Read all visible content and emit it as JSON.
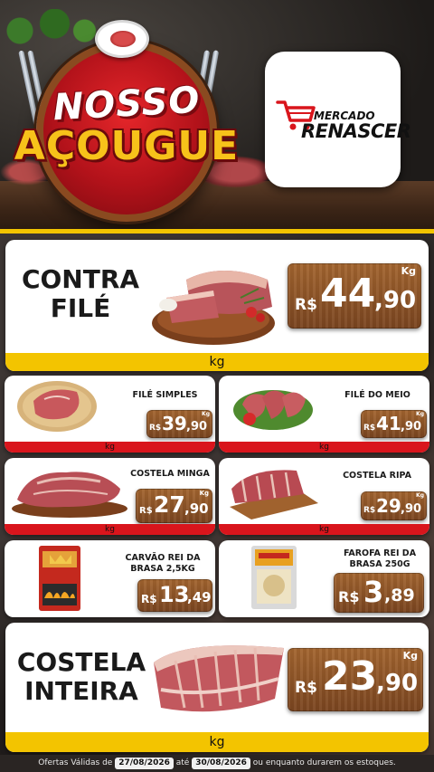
{
  "header": {
    "banner_line1": "NOSSO",
    "banner_line2": "AÇOUGUE",
    "logo_line1": "MERCADO",
    "logo_line2": "RENASCER"
  },
  "colors": {
    "yellow": "#f3c400",
    "red": "#d9151c",
    "wood": "#8a5128"
  },
  "featured_top": {
    "name_line1": "CONTRA",
    "name_line2": "FILÉ",
    "unit": "Kg",
    "currency": "R$",
    "price_int": "44",
    "price_dec": ",90",
    "footer": "kg"
  },
  "products": [
    {
      "name": "FILÉ SIMPLES",
      "unit": "Kg",
      "currency": "R$",
      "price_int": "39",
      "price_dec": ",90",
      "footer": "kg",
      "image": "steak-on-board-icon"
    },
    {
      "name": "FILÉ DO MEIO",
      "unit": "Kg",
      "currency": "R$",
      "price_int": "41",
      "price_dec": ",90",
      "footer": "kg",
      "image": "tbone-steaks-icon"
    },
    {
      "name": "COSTELA MINGA",
      "unit": "Kg",
      "currency": "R$",
      "price_int": "27",
      "price_dec": ",90",
      "footer": "kg",
      "image": "beef-roast-icon"
    },
    {
      "name": "COSTELA RIPA",
      "unit": "Kg",
      "currency": "R$",
      "price_int": "29",
      "price_dec": ",90",
      "footer": "kg",
      "image": "rib-strips-icon"
    },
    {
      "name": "CARVÃO REI DA BRASA 2,5KG",
      "unit": "",
      "currency": "R$",
      "price_int": "13",
      "price_dec": ",49",
      "footer": "",
      "image": "charcoal-bag-icon"
    },
    {
      "name": "FAROFA REI DA BRASA 250G",
      "unit": "",
      "currency": "R$",
      "price_int": "3",
      "price_dec": ",89",
      "footer": "",
      "image": "farofa-package-icon"
    }
  ],
  "featured_bottom": {
    "name_line1": "COSTELA",
    "name_line2": "INTEIRA",
    "unit": "Kg",
    "currency": "R$",
    "price_int": "23",
    "price_dec": ",90",
    "footer": "kg"
  },
  "footer": {
    "prefix": "Ofertas Válidas de",
    "date_start": "27/08/2026",
    "middle": "até",
    "date_end": "30/08/2026",
    "suffix": "ou enquanto durarem os estoques."
  }
}
